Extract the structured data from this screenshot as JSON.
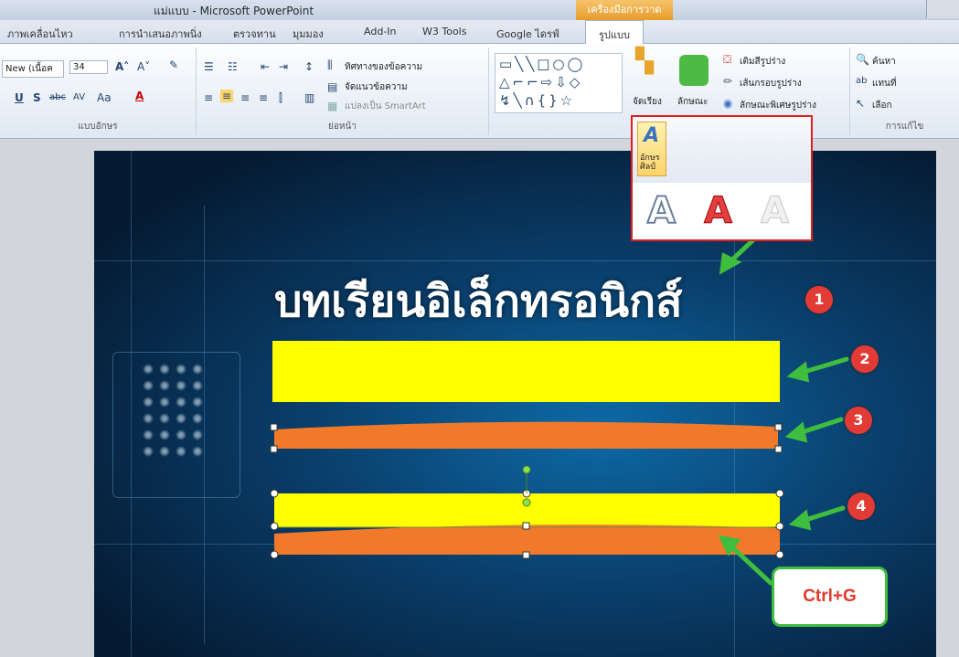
{
  "window": {
    "title": "แม่แบบ - Microsoft PowerPoint",
    "context_tab": "เครื่องมือการวาด"
  },
  "tabs": [
    {
      "label": "ภาพเคลื่อนไหว"
    },
    {
      "label": "การนำเสนอภาพนิ่ง"
    },
    {
      "label": "ตรวจทาน"
    },
    {
      "label": "มุมมอง"
    },
    {
      "label": "Add-In"
    },
    {
      "label": "W3 Tools"
    },
    {
      "label": "Google ไดรฟ์"
    },
    {
      "label": "รูปแบบ"
    }
  ],
  "ribbon": {
    "font": {
      "name": "New (เนื้อค",
      "size": "34",
      "group_label": "แบบอักษร"
    },
    "paragraph": {
      "text_direction": "ทิศทางของข้อความ",
      "align_text": "จัดแนวข้อความ",
      "convert_smartart": "แปลงเป็น SmartArt",
      "group_label": "ย่อหน้า"
    },
    "drawing": {
      "arrange": "จัดเรียง",
      "quick_styles": "ลักษณะ",
      "shape_fill": "เติมสีรูปร่าง",
      "shape_outline": "เส้นกรอบรูปร่าง",
      "shape_effects": "ลักษณะพิเศษรูปร่าง"
    },
    "editing": {
      "find": "ค้นหา",
      "replace": "แทนที่",
      "select": "เลือก",
      "group_label": "การแก้ไข"
    }
  },
  "popup": {
    "wordart_label": "อักษรศิลป์",
    "styles": [
      "A",
      "A",
      "A"
    ]
  },
  "slide": {
    "title_text": "บทเรียนอิเล็กทรอนิกส์",
    "markers": [
      "1",
      "2",
      "3",
      "4"
    ],
    "callout": "Ctrl+G"
  },
  "colors": {
    "yellow": "#ffff00",
    "orange": "#f07a2a",
    "marker": "#e23a34",
    "arrow": "#3ebd3e",
    "popup_border": "#e02020"
  }
}
